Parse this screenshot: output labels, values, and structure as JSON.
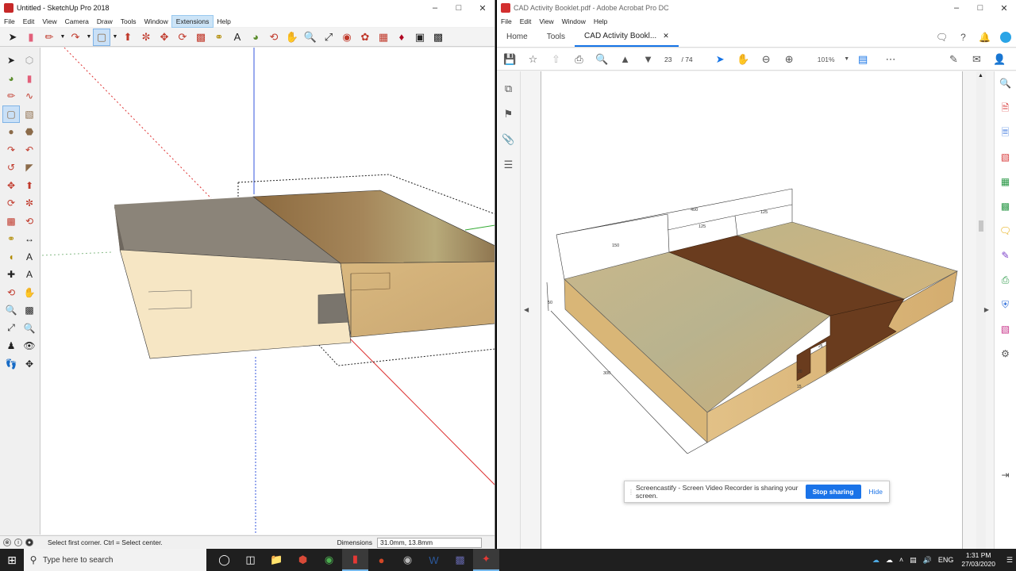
{
  "sketchup": {
    "title": "Untitled - SketchUp Pro 2018",
    "menu": [
      "File",
      "Edit",
      "View",
      "Camera",
      "Draw",
      "Tools",
      "Window",
      "Extensions",
      "Help"
    ],
    "highlighted_menu": "Extensions",
    "status_hint": "Select first corner. Ctrl = Select center.",
    "dimensions_label": "Dimensions",
    "dimensions_value": "31.0mm, 13.8mm",
    "colors": {
      "light_face": "#f6e6c4",
      "gray_top": "#8b8479",
      "wood": "#c9a772"
    }
  },
  "acrobat": {
    "title": "CAD Activity Booklet.pdf - Adobe Acrobat Pro DC",
    "menu": [
      "File",
      "Edit",
      "View",
      "Window",
      "Help"
    ],
    "tabs": {
      "home": "Home",
      "tools": "Tools",
      "document": "CAD Activity Bookl..."
    },
    "page_current": "23",
    "page_total": "/ 74",
    "zoom": "101%",
    "drawing": {
      "dim_400": "400",
      "dim_125a": "125",
      "dim_125b": "125",
      "dim_150": "150",
      "dim_50": "50",
      "dim_300": "300",
      "dim_25": "25",
      "dim_20": "20",
      "dim_15": "15"
    },
    "share_banner": {
      "message": "Screencastify - Screen Video Recorder is sharing your screen.",
      "stop": "Stop sharing",
      "hide": "Hide"
    }
  },
  "taskbar": {
    "search_placeholder": "Type here to search",
    "language": "ENG",
    "time": "1:31 PM",
    "date": "27/03/2020"
  }
}
